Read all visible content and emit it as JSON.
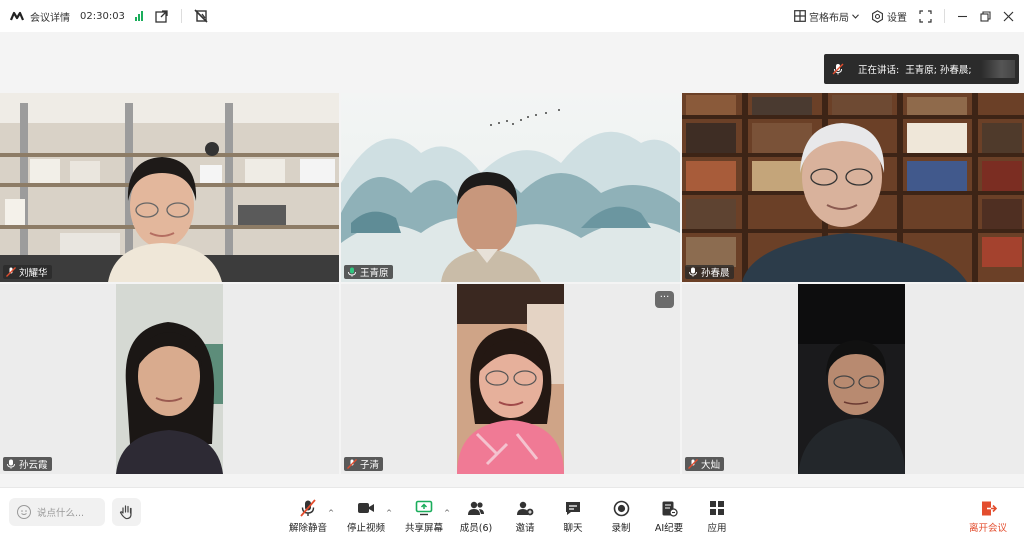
{
  "titlebar": {
    "meeting_details_label": "会议详情",
    "elapsed_time": "02:30:03",
    "layout_label": "宫格布局",
    "settings_label": "设置"
  },
  "speaking": {
    "label": "正在讲话:",
    "names": "王青原; 孙春晨;"
  },
  "participants": [
    {
      "name": "刘耀华",
      "mic": "muted"
    },
    {
      "name": "王青原",
      "mic": "on",
      "highlighted": true
    },
    {
      "name": "孙春晨",
      "mic": "on"
    },
    {
      "name": "孙云霞",
      "mic": "on"
    },
    {
      "name": "子清",
      "mic": "muted"
    },
    {
      "name": "大灿",
      "mic": "muted"
    }
  ],
  "more_button": "···",
  "chat": {
    "placeholder": "说点什么..."
  },
  "toolbar": {
    "unmute": "解除静音",
    "stop_video": "停止视频",
    "share_screen": "共享屏幕",
    "members": "成员(6)",
    "invite": "邀请",
    "chat": "聊天",
    "record": "录制",
    "ai_minutes": "AI纪要",
    "apps": "应用",
    "leave": "离开会议"
  },
  "colors": {
    "accent_green": "#2fc780",
    "leave_red": "#e34d2e",
    "signal_green": "#1aad5b"
  }
}
